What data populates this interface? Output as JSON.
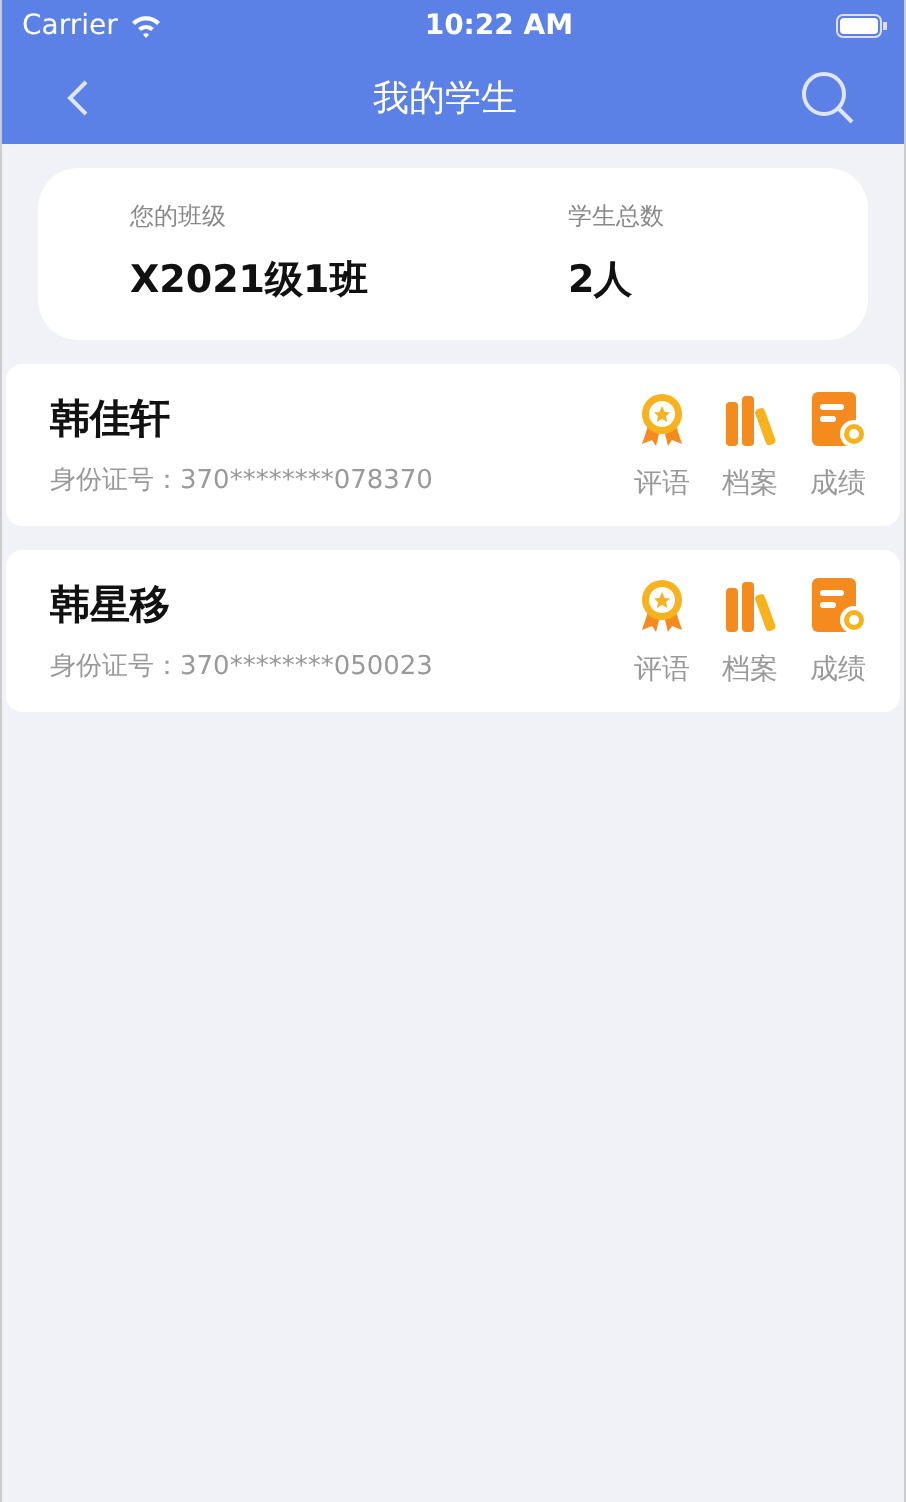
{
  "status_bar": {
    "carrier": "Carrier",
    "time": "10:22 AM"
  },
  "nav": {
    "title": "我的学生"
  },
  "summary": {
    "class_label": "您的班级",
    "class_value": "X2021级1班",
    "count_label": "学生总数",
    "count_value": "2人"
  },
  "students": [
    {
      "name": "韩佳轩",
      "id_text": "身份证号：370********078370",
      "actions": [
        {
          "kind": "award",
          "label": "评语"
        },
        {
          "kind": "books",
          "label": "档案"
        },
        {
          "kind": "report",
          "label": "成绩"
        }
      ]
    },
    {
      "name": "韩星移",
      "id_text": "身份证号：370********050023",
      "actions": [
        {
          "kind": "award",
          "label": "评语"
        },
        {
          "kind": "books",
          "label": "档案"
        },
        {
          "kind": "report",
          "label": "成绩"
        }
      ]
    }
  ]
}
